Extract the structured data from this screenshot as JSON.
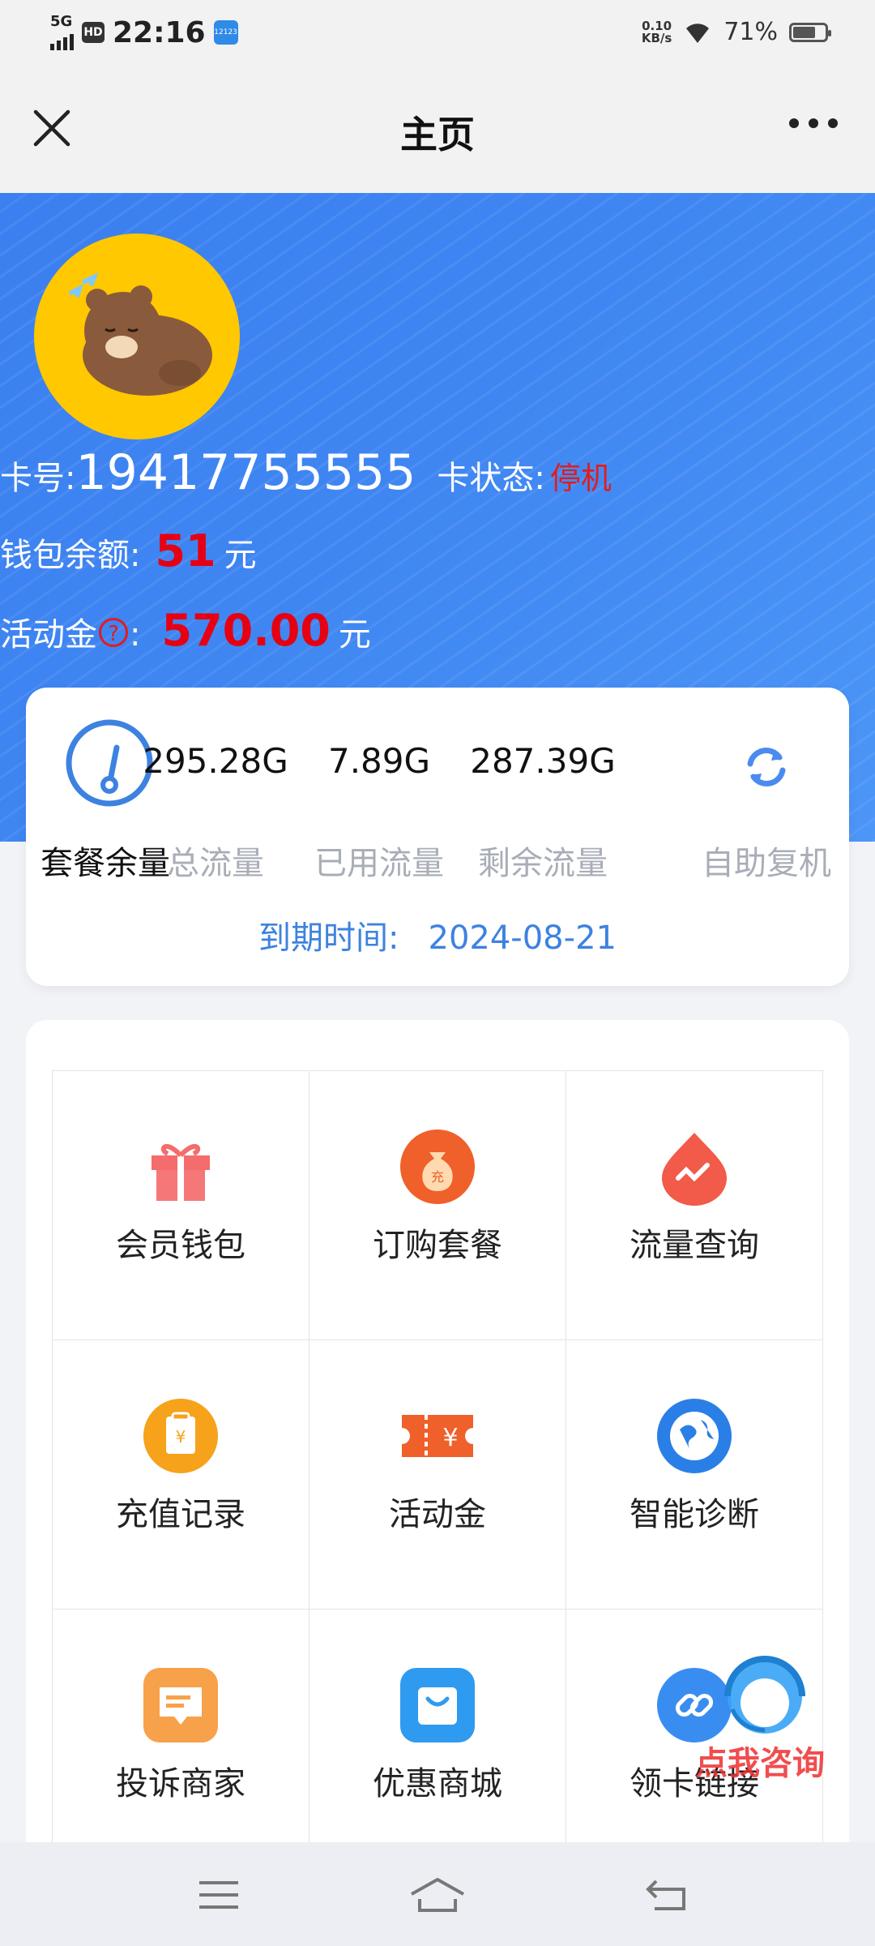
{
  "status_bar": {
    "network": "5G",
    "hd": "HD",
    "time": "22:16",
    "speed_value": "0.10",
    "speed_unit": "KB/s",
    "battery": "71%",
    "battery_level": 0.71
  },
  "nav": {
    "title": "主页"
  },
  "profile": {
    "card_no_label": "卡号:",
    "card_no": "19417755555",
    "status_label": "卡状态:",
    "status_value": "停机",
    "wallet_label": "钱包余额:",
    "wallet_value": "51",
    "wallet_unit": "元",
    "activity_label": "活动金",
    "activity_help": "?",
    "activity_colon": ":",
    "activity_value": "570.00",
    "activity_unit": "元"
  },
  "data_card": {
    "package_label": "套餐余量",
    "total_value": "295.28G",
    "total_label": "总流量",
    "used_value": "7.89G",
    "used_label": "已用流量",
    "remain_value": "287.39G",
    "remain_label": "剩余流量",
    "reactivate_label": "自助复机",
    "expire_label": "到期时间:",
    "expire_date": "2024-08-21"
  },
  "grid": [
    {
      "label": "会员钱包",
      "icon": "gift-icon"
    },
    {
      "label": "订购套餐",
      "icon": "money-bag-icon"
    },
    {
      "label": "流量查询",
      "icon": "traffic-drop-icon"
    },
    {
      "label": "充值记录",
      "icon": "recharge-record-icon"
    },
    {
      "label": "活动金",
      "icon": "ticket-icon"
    },
    {
      "label": "智能诊断",
      "icon": "globe-icon"
    },
    {
      "label": "投诉商家",
      "icon": "complaint-icon"
    },
    {
      "label": "优惠商城",
      "icon": "shopping-bag-icon"
    },
    {
      "label": "领卡链接",
      "icon": "link-icon"
    }
  ],
  "grid_icon_glyphs": {
    "money_bag": "充",
    "ticket": "¥",
    "record": "¥"
  },
  "consult": {
    "label": "点我咨询"
  },
  "colors": {
    "hero_blue": "#3f86f2",
    "alert_red": "#e60012",
    "link_blue": "#3d82e0"
  }
}
